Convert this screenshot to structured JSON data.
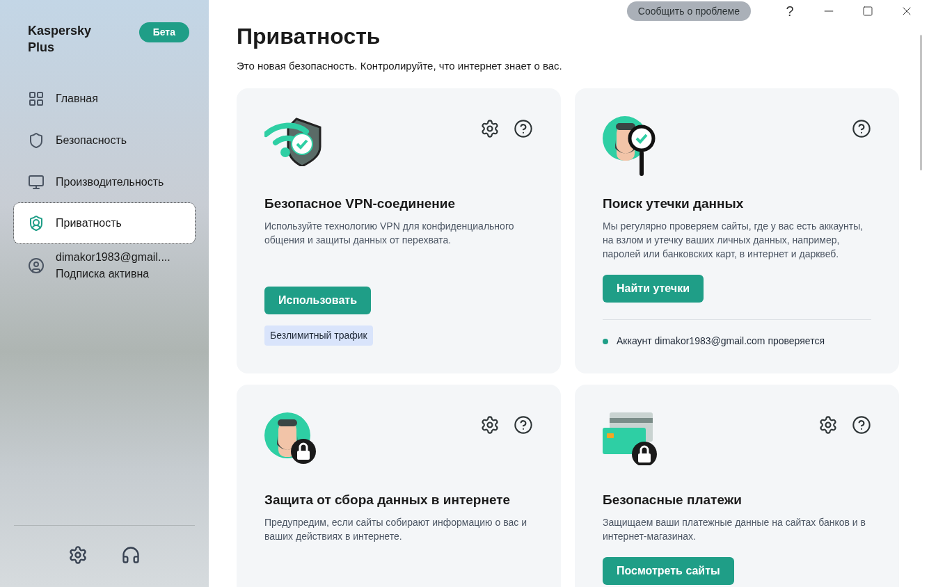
{
  "app": {
    "name": "Kaspersky Plus",
    "badge": "Бета"
  },
  "nav": [
    {
      "label": "Главная",
      "selected": false
    },
    {
      "label": "Безопасность",
      "selected": false
    },
    {
      "label": "Производительность",
      "selected": false
    },
    {
      "label": "Приватность",
      "selected": true
    }
  ],
  "account": {
    "email": "dimakor1983@gmail....",
    "status": "Подписка активна"
  },
  "titlebar": {
    "report_button": "Сообщить о проблеме",
    "help": "?"
  },
  "page": {
    "title": "Приватность",
    "subtitle": "Это новая безопасность. Контролируйте, что интернет знает о вас."
  },
  "cards": [
    {
      "kind": "vpn",
      "settings_icon": true,
      "help_icon": true,
      "title": "Безопасное VPN-соединение",
      "description": "Используйте технологию VPN для конфиденциального общения и защиты данных от перехвата.",
      "button": "Использовать",
      "tag": "Безлимитный трафик"
    },
    {
      "kind": "leak",
      "settings_icon": false,
      "help_icon": true,
      "title": "Поиск утечки данных",
      "description": "Мы регулярно проверяем сайты, где у вас есть аккаунты, на взлом и утечку ваших личных данных, например, паролей или банковских карт, в интернет и дарквеб.",
      "button": "Найти утечки",
      "status": {
        "text": "Аккаунт dimakor1983@gmail.com проверяется",
        "color": "#1f9e87"
      }
    },
    {
      "kind": "tracking",
      "settings_icon": true,
      "help_icon": true,
      "title": "Защита от сбора данных в интернете",
      "description": "Предупредим, если сайты собирают информацию о вас и ваших действиях в интернете."
    },
    {
      "kind": "payments",
      "settings_icon": true,
      "help_icon": true,
      "title": "Безопасные платежи",
      "description": "Защищаем ваши платежные данные на сайтах банков и в интернет-магазинах.",
      "button": "Посмотреть сайты"
    }
  ]
}
